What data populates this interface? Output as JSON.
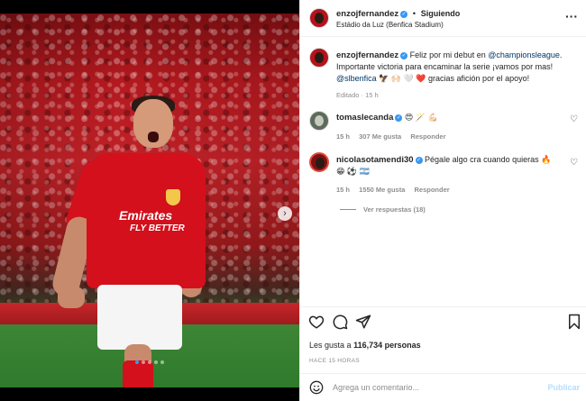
{
  "post": {
    "author": {
      "username": "enzojfernandez",
      "verified": true,
      "follow_status": "Siguiendo",
      "separator": "•",
      "location": "Estádio da Luz (Benfica Stadium)"
    },
    "menu_icon": "more-horizontal-icon",
    "media": {
      "sponsor_text": "Emirates",
      "sponsor_subtext": "FLY BETTER",
      "next_icon": "chevron-right-icon",
      "carousel_total": 5,
      "carousel_active": 1
    },
    "caption": {
      "username": "enzojfernandez",
      "text_1": "Feliz por mi debut en",
      "mention_1": "@championsleague",
      "text_2": ". Importante victoria para encaminar la serie ¡vamos por mas!",
      "mention_2": "@slbenfica",
      "emojis": "🦅 🙌🏻 🤍 ❤️",
      "text_3": "gracias afición por el apoyo!",
      "edited": "Editado",
      "dot": "·",
      "age": "15 h"
    },
    "comments": [
      {
        "username": "tomaslecanda",
        "verified": true,
        "text": "😍 🪄 💪🏻",
        "age": "15 h",
        "likes": "307 Me gusta",
        "reply": "Responder"
      },
      {
        "username": "nicolasotamendi30",
        "verified": true,
        "text": "Pégale algo cra cuando quieras 🔥 😁 ⚽ 🇦🇷",
        "age": "15 h",
        "likes": "1550 Me gusta",
        "reply": "Responder",
        "view_replies": "Ver respuestas (18)"
      }
    ],
    "actions": {
      "like_icon": "heart-icon",
      "comment_icon": "comment-icon",
      "share_icon": "send-icon",
      "save_icon": "bookmark-icon"
    },
    "likes": {
      "prefix": "Les gusta a",
      "count": "116,734",
      "suffix": "personas"
    },
    "timestamp": "HACE 15 HORAS",
    "comment_box": {
      "emoji_icon": "smiley-icon",
      "placeholder": "Agrega un comentario...",
      "publish_label": "Publicar"
    },
    "colors": {
      "accent": "#3897f0",
      "link": "#00376b",
      "publish_disabled": "#b2dffc",
      "jersey": "#d3101c"
    }
  }
}
